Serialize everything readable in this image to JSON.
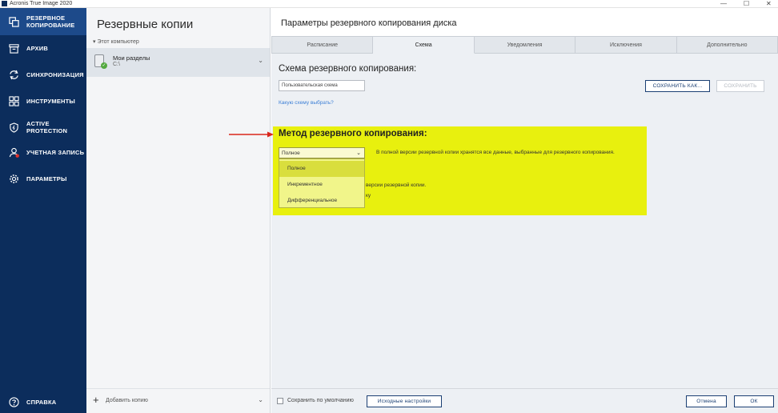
{
  "window": {
    "title": "Acronis True Image 2020",
    "controls": [
      "—",
      "☐",
      "✕"
    ]
  },
  "nav": {
    "items": [
      {
        "label": "РЕЗЕРВНОЕ\nКОПИРОВАНИЕ",
        "icon": "backup-copies-icon",
        "active": true
      },
      {
        "label": "АРХИВ",
        "icon": "archive-icon",
        "active": false
      },
      {
        "label": "СИНХРОНИЗАЦИЯ",
        "icon": "sync-icon",
        "active": false
      },
      {
        "label": "ИНСТРУМЕНТЫ",
        "icon": "tools-grid-icon",
        "active": false
      },
      {
        "label": "ACTIVE\nPROTECTION",
        "icon": "shield-icon",
        "active": false
      },
      {
        "label": "УЧЕТНАЯ ЗАПИСЬ",
        "icon": "user-icon",
        "active": false
      },
      {
        "label": "ПАРАМЕТРЫ",
        "icon": "gear-icon",
        "active": false
      }
    ],
    "help": {
      "label": "СПРАВКА",
      "icon": "help-icon"
    }
  },
  "middle": {
    "title": "Резервные копии",
    "group": "Этот компьютер",
    "item": {
      "name": "Мои разделы",
      "sub": "C:\\"
    },
    "add_label": "Добавить копию"
  },
  "right": {
    "title": "Параметры резервного копирования диска",
    "tabs": [
      {
        "label": "Расписание",
        "active": false
      },
      {
        "label": "Схема",
        "active": true
      },
      {
        "label": "Уведомления",
        "active": false
      },
      {
        "label": "Исключения",
        "active": false
      },
      {
        "label": "Дополнительно",
        "active": false
      }
    ],
    "scheme_title": "Схема резервного копирования:",
    "scheme_value": "Пользовательская схема",
    "scheme_link": "Какую схему выбрать?",
    "save_as_label": "СОХРАНИТЬ КАК...",
    "save_label": "СОХРАНИТЬ",
    "method_title": "Метод резервного копирования:",
    "method_value": "Полное",
    "method_options": [
      "Полное",
      "Инкрементное",
      "Дифференциальное"
    ],
    "method_desc": "В полной версии резервной копии хранятся все данные, выбранные для резервного копирования.",
    "desc_line2": "версии резервной копии.",
    "desc_line3": "ку"
  },
  "bottom": {
    "save_default_label": "Сохранить по умолчанию",
    "defaults_label": "Исходные настройки",
    "cancel_label": "Отмена",
    "ok_label": "ОК"
  },
  "colors": {
    "nav_bg": "#0c2d5c",
    "nav_active": "#1d4a8a",
    "highlight": "#e8f00e",
    "arrow": "#d9261c",
    "link": "#3c7fd6"
  }
}
